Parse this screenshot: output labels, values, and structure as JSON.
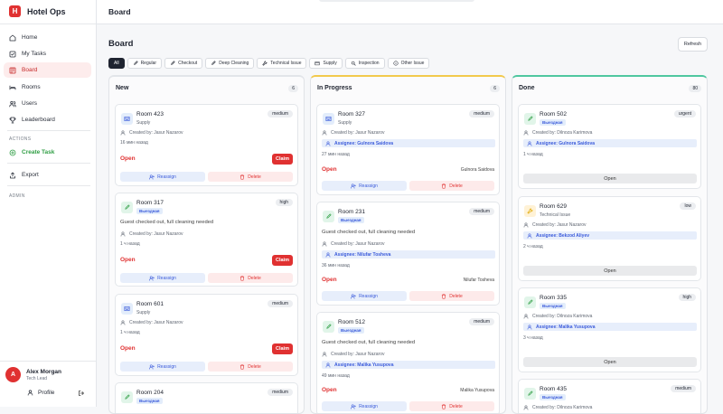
{
  "brand": {
    "logo_letter": "H",
    "title": "Hotel Ops"
  },
  "nav": [
    {
      "label": "Home"
    },
    {
      "label": "My Tasks"
    },
    {
      "label": "Board"
    },
    {
      "label": "Rooms"
    },
    {
      "label": "Users"
    },
    {
      "label": "Leaderboard"
    }
  ],
  "actions_label": "ACTIONS",
  "create_task": "Create Task",
  "export": "Export",
  "admin_label": "ADMIN",
  "user": {
    "initial": "A",
    "name": "Alex Morgan",
    "role": "Tech Lead",
    "profile": "Profile"
  },
  "header": {
    "title": "Board"
  },
  "board": {
    "title": "Board",
    "refresh": "Refresh"
  },
  "filters": [
    "All",
    "Regular",
    "Checkout",
    "Deep Cleaning",
    "Technical Issue",
    "Supply",
    "Inspection",
    "Other Issue"
  ],
  "columns": [
    {
      "title": "New",
      "count": "6",
      "cards": [
        {
          "room": "Room 423",
          "sub": "Supply",
          "priority": "medium",
          "created": "Created by: Jasur Nazarov",
          "ago": "16 мин назад",
          "status": "Open",
          "claim": "Claim",
          "reassign": "Reassign",
          "delete": "Delete"
        },
        {
          "room": "Room 317",
          "badge": "Выездная",
          "priority": "high",
          "desc": "Guest checked out, full cleaning needed",
          "created": "Created by: Jasur Nazarov",
          "ago": "1 ч назад",
          "status": "Open",
          "claim": "Claim",
          "reassign": "Reassign",
          "delete": "Delete"
        },
        {
          "room": "Room 601",
          "sub": "Supply",
          "priority": "medium",
          "created": "Created by: Jasur Nazarov",
          "ago": "1 ч назад",
          "status": "Open",
          "claim": "Claim",
          "reassign": "Reassign",
          "delete": "Delete"
        },
        {
          "room": "Room 204",
          "badge": "Выездная",
          "priority": "medium"
        }
      ]
    },
    {
      "title": "In Progress",
      "count": "6",
      "cards": [
        {
          "room": "Room 327",
          "sub": "Supply",
          "priority": "medium",
          "created": "Created by: Jasur Nazarov",
          "assignee": "Assignee: Gulnora Saidova",
          "ago": "27 мин назад",
          "status": "Open",
          "who": "Gulnora Saidova",
          "reassign": "Reassign",
          "delete": "Delete"
        },
        {
          "room": "Room 231",
          "badge": "Выездная",
          "priority": "medium",
          "desc": "Guest checked out, full cleaning needed",
          "created": "Created by: Jasur Nazarov",
          "assignee": "Assignee: Nilufar Tosheva",
          "ago": "36 мин назад",
          "status": "Open",
          "who": "Nilufar Tosheva",
          "reassign": "Reassign",
          "delete": "Delete"
        },
        {
          "room": "Room 512",
          "badge": "Выездная",
          "priority": "medium",
          "desc": "Guest checked out, full cleaning needed",
          "created": "Created by: Jasur Nazarov",
          "assignee": "Assignee: Malika Yusupova",
          "ago": "49 мин назад",
          "status": "Open",
          "who": "Malika Yusupova",
          "reassign": "Reassign",
          "delete": "Delete"
        }
      ]
    },
    {
      "title": "Done",
      "count": "80",
      "cards": [
        {
          "room": "Room 502",
          "badge": "Выездная",
          "priority": "urgent",
          "created": "Created by: Dilnoza Karimova",
          "assignee": "Assignee: Gulnora Saidova",
          "ago": "1 ч назад",
          "open": "Open"
        },
        {
          "room": "Room 629",
          "sub": "Technical Issue",
          "priority": "low",
          "created": "Created by: Jasur Nazarov",
          "assignee": "Assignee: Bekzod Aliyev",
          "ago": "2 ч назад",
          "open": "Open"
        },
        {
          "room": "Room 335",
          "badge": "Выездная",
          "priority": "high",
          "created": "Created by: Dilnoza Karimova",
          "assignee": "Assignee: Malika Yusupova",
          "ago": "3 ч назад",
          "open": "Open"
        },
        {
          "room": "Room 435",
          "badge": "Выездная",
          "priority": "medium",
          "created": "Created by: Dilnoza Karimova"
        }
      ]
    }
  ]
}
